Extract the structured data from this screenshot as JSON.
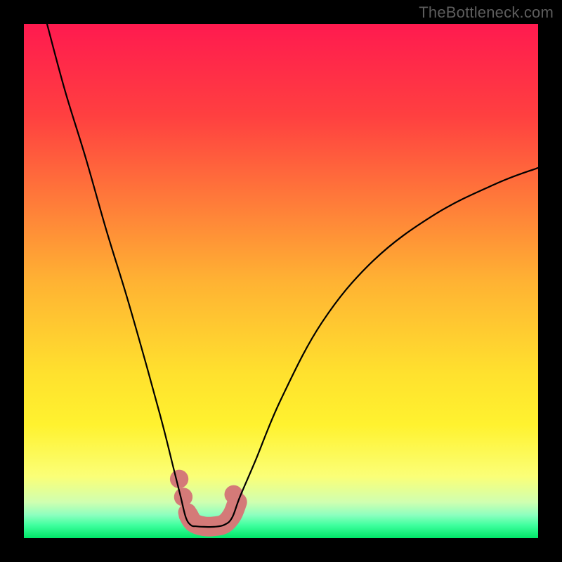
{
  "watermark": {
    "text": "TheBottleneck.com"
  },
  "chart_data": {
    "type": "line",
    "title": "",
    "xlabel": "",
    "ylabel": "",
    "xlim": [
      0,
      100
    ],
    "ylim": [
      0,
      100
    ],
    "grid": false,
    "legend": false,
    "annotations": [],
    "background_gradient_stops": [
      {
        "offset": 0.0,
        "color": "#ff1a4f"
      },
      {
        "offset": 0.18,
        "color": "#ff4040"
      },
      {
        "offset": 0.5,
        "color": "#ffb233"
      },
      {
        "offset": 0.68,
        "color": "#ffe12e"
      },
      {
        "offset": 0.78,
        "color": "#fff22f"
      },
      {
        "offset": 0.88,
        "color": "#fbff77"
      },
      {
        "offset": 0.93,
        "color": "#d0ffb0"
      },
      {
        "offset": 0.955,
        "color": "#8dffbf"
      },
      {
        "offset": 0.975,
        "color": "#3fff9e"
      },
      {
        "offset": 1.0,
        "color": "#00e668"
      }
    ],
    "series": [
      {
        "name": "bottleneck-curve",
        "color": "#000000",
        "x": [
          4.5,
          8,
          12,
          16,
          20,
          24,
          27,
          29,
          30.5,
          31.5,
          32.5,
          33.5,
          35,
          37,
          39,
          40.5,
          42,
          45,
          50,
          58,
          68,
          80,
          92,
          100
        ],
        "y": [
          100,
          87,
          74,
          60,
          47,
          33,
          22,
          14,
          8,
          4,
          2.5,
          2.3,
          2.2,
          2.2,
          2.6,
          4,
          8,
          15,
          27,
          42,
          54,
          63,
          69,
          72
        ]
      }
    ],
    "markers": [
      {
        "name": "left-band-top",
        "x": 30.2,
        "y": 11.5,
        "r": 1.8,
        "color": "#d47a78"
      },
      {
        "name": "left-band-upper",
        "x": 31.0,
        "y": 8.0,
        "r": 1.8,
        "color": "#d47a78"
      },
      {
        "name": "left-band-lower",
        "x": 31.8,
        "y": 5.0,
        "r": 1.8,
        "color": "#d47a78"
      },
      {
        "name": "right-band-top",
        "x": 40.8,
        "y": 8.5,
        "r": 1.8,
        "color": "#d47a78"
      }
    ],
    "floor_band": {
      "color": "#d47a78",
      "width": 3.8,
      "points": [
        {
          "x": 32.0,
          "y": 4.5
        },
        {
          "x": 33.0,
          "y": 3.0
        },
        {
          "x": 35.0,
          "y": 2.3
        },
        {
          "x": 37.0,
          "y": 2.3
        },
        {
          "x": 39.0,
          "y": 2.8
        },
        {
          "x": 40.5,
          "y": 4.5
        },
        {
          "x": 41.5,
          "y": 7.0
        }
      ]
    }
  }
}
